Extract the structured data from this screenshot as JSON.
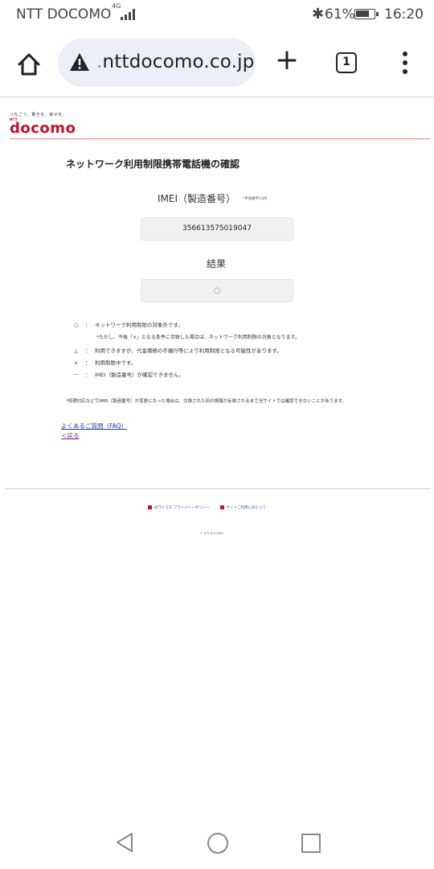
{
  "status_bar": {
    "carrier": "NTT DOCOMO",
    "network": "4G",
    "battery_percent": "61%",
    "time": "16:20",
    "bluetooth_glyph": "✱"
  },
  "browser": {
    "url_prefix": ".",
    "url": "nttdocomo.co.jp",
    "tab_count": "1",
    "new_tab_glyph": "+"
  },
  "site": {
    "tagline": "つなごう。驚きを。幸せを。",
    "logo_small": "NTT",
    "logo": "docomo",
    "page_title": "ネットワーク利用制限携帯電話機の確認",
    "imei_label": "IMEI（製造番号）",
    "imei_note": "*半角数字15桁",
    "imei_value": "356613575019047",
    "result_label": "結果",
    "result_value": "○"
  },
  "legend": [
    {
      "symbol": "○",
      "text": "ネットワーク利用制限の対象外です。"
    },
    {
      "symbol": "",
      "text": "*ただし、今後「×」となる条件に合致した場合は、ネットワーク利用制限の対象となります。"
    },
    {
      "symbol": "△",
      "text": "利用できますが、代金債務の不履行等により利用制限となる可能性があります。"
    },
    {
      "symbol": "×",
      "text": "利用制限中です。"
    },
    {
      "symbol": "－",
      "text": "IMEI（製造番号）が確認できません。"
    }
  ],
  "legend_separator": "：",
  "footnote": "*修理対応などでIMEI（製造番号）が変更になった場合は、交換された旧の情報が反映されるまで当サイトでは確認できないことがあります。",
  "links": {
    "faq": "よくあるご質問（FAQ）",
    "back": "＜戻る"
  },
  "footer": {
    "privacy": "NTTドコモ プライバシーポリシー",
    "site_usage": "サイトご利用にあたって",
    "copyright": "© NTT DOCOMO"
  },
  "colors": {
    "brand_red": "#c8102e",
    "url_bar_bg": "#eceff6",
    "link_blue": "#1a3fa6",
    "visited_purple": "#7a2a8a"
  }
}
